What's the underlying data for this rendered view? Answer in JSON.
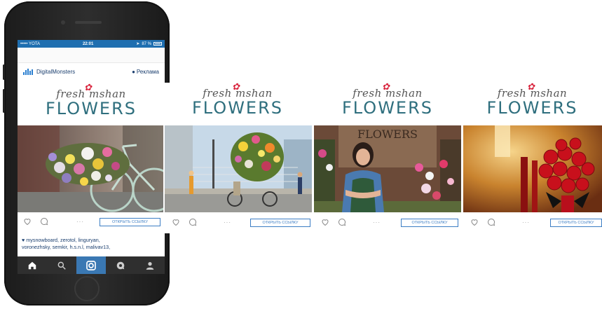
{
  "status": {
    "carrier": "••••• YOTA",
    "time": "22:01",
    "battery": "87 %"
  },
  "post": {
    "account": "DigitalMonsters",
    "sponsored": "Реклама",
    "logo_script": "fresh mshan",
    "logo_word": "FLOWERS",
    "cta": "ОТКРЫТЬ ССЫЛКУ",
    "more": "···",
    "likes": "♥ mysnowboard, zerotol, linguryan,",
    "caption_line2": "voronezhsky, semkir, h.s.n.l, malivav13,"
  },
  "carousel": [
    {
      "logo_script": "fresh mshan",
      "logo_word": "FLOWERS",
      "cta": "ОТКРЫТЬ ССЫЛКУ",
      "more": "···",
      "scene": "flower-bicycle-street"
    },
    {
      "logo_script": "fresh mshan",
      "logo_word": "FLOWERS",
      "cta": "ОТКРЫТЬ ССЫЛКУ",
      "more": "···",
      "scene": "florist-shop",
      "shop_sign": "FLOWERS"
    },
    {
      "logo_script": "fresh mshan",
      "logo_word": "FLOWERS",
      "cta": "ОТКРЫТЬ ССЫЛКУ",
      "more": "···",
      "scene": "red-roses-bouquet"
    }
  ],
  "icons": [
    "home-icon",
    "search-icon",
    "camera-icon",
    "chat-icon",
    "profile-icon",
    "heart-icon",
    "comment-icon",
    "rose-icon"
  ],
  "colors": {
    "accent": "#3b7dc4",
    "status_bar": "#1f6fb0",
    "logo_teal": "#2f6f7e",
    "rose": "#d9253e",
    "tabbar": "#2f2f2f"
  }
}
